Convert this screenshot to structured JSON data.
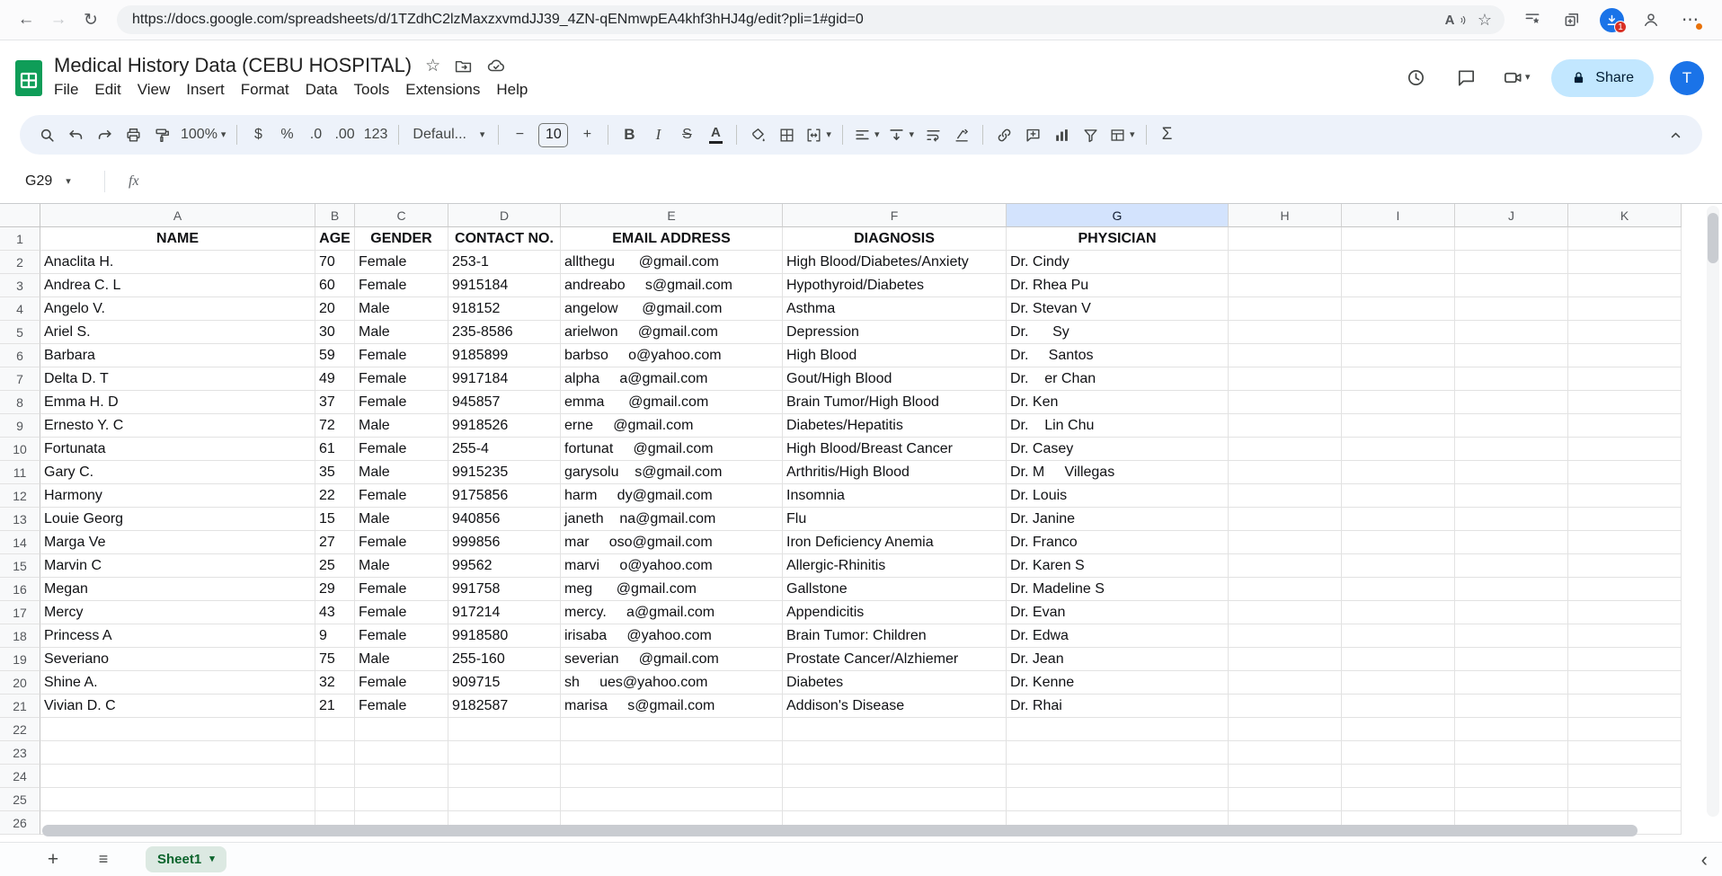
{
  "browser": {
    "url": "https://docs.google.com/spreadsheets/d/1TZdhC2lzMaxzxvmdJJ39_4ZN-qENmwpEA4khf3hHJ4g/edit?pli=1#gid=0",
    "downloads_badge": "1"
  },
  "icons": {
    "back": "←",
    "forward": "→",
    "refresh": "↻",
    "read_aloud": "A",
    "favorite_star": "☆",
    "ellipsis": "⋯",
    "doc_star": "☆",
    "caret": "▾",
    "minus": "−",
    "plus": "+",
    "hamburger": "≡",
    "chevron_left": "‹",
    "downloads_arrow": "↓"
  },
  "header": {
    "title": "Medical History Data (CEBU HOSPITAL)",
    "menus": [
      "File",
      "Edit",
      "View",
      "Insert",
      "Format",
      "Data",
      "Tools",
      "Extensions",
      "Help"
    ],
    "share_label": "Share",
    "avatar_letter": "T"
  },
  "toolbar": {
    "zoom": "100%",
    "currency": "$",
    "percent": "%",
    "dec_dec": ".0",
    "dec_inc": ".00",
    "number_format": "123",
    "font_name": "Defaul...",
    "font_size": "10",
    "bold": "B",
    "italic": "I",
    "strike": "S",
    "text_color": "A",
    "functions": "Σ"
  },
  "formula_bar": {
    "cell_ref": "G29",
    "fx_label": "fx"
  },
  "grid": {
    "column_letters": [
      "A",
      "B",
      "C",
      "D",
      "E",
      "F",
      "G",
      "H",
      "I",
      "J",
      "K"
    ],
    "selected_column": "G",
    "visible_rows": 26,
    "header_row": [
      "NAME",
      "AGE",
      "GENDER",
      "CONTACT NO.",
      "EMAIL ADDRESS",
      "DIAGNOSIS",
      "PHYSICIAN"
    ],
    "rows": [
      {
        "name": "Anaclita H.",
        "age": "70",
        "gender": "Female",
        "contact": "253-1",
        "email": "allthegu      @gmail.com",
        "diagnosis": "High Blood/Diabetes/Anxiety",
        "physician": "Dr. Cindy"
      },
      {
        "name": "Andrea C. L",
        "age": "60",
        "gender": "Female",
        "contact": "9915184",
        "email": "andreabo     s@gmail.com",
        "diagnosis": "Hypothyroid/Diabetes",
        "physician": "Dr. Rhea Pu"
      },
      {
        "name": "Angelo V.",
        "age": "20",
        "gender": "Male",
        "contact": "918152",
        "email": "angelow      @gmail.com",
        "diagnosis": "Asthma",
        "physician": "Dr. Stevan V"
      },
      {
        "name": "Ariel S.",
        "age": "30",
        "gender": "Male",
        "contact": "235-8586",
        "email": "arielwon     @gmail.com",
        "diagnosis": "Depression",
        "physician": "Dr.      Sy"
      },
      {
        "name": "Barbara",
        "age": "59",
        "gender": "Female",
        "contact": "9185899",
        "email": "barbso     o@yahoo.com",
        "diagnosis": "High Blood",
        "physician": "Dr.     Santos"
      },
      {
        "name": "Delta D. T",
        "age": "49",
        "gender": "Female",
        "contact": "9917184",
        "email": "alpha     a@gmail.com",
        "diagnosis": "Gout/High Blood",
        "physician": "Dr.    er Chan"
      },
      {
        "name": "Emma H. D",
        "age": "37",
        "gender": "Female",
        "contact": "945857",
        "email": "emma      @gmail.com",
        "diagnosis": "Brain Tumor/High Blood",
        "physician": "Dr. Ken"
      },
      {
        "name": "Ernesto Y. C",
        "age": "72",
        "gender": "Male",
        "contact": "9918526",
        "email": "erne     @gmail.com",
        "diagnosis": "Diabetes/Hepatitis",
        "physician": "Dr.    Lin Chu"
      },
      {
        "name": "Fortunata",
        "age": "61",
        "gender": "Female",
        "contact": "255-4",
        "email": "fortunat     @gmail.com",
        "diagnosis": "High Blood/Breast Cancer",
        "physician": "Dr. Casey"
      },
      {
        "name": "Gary C.",
        "age": "35",
        "gender": "Male",
        "contact": "9915235",
        "email": "garysolu    s@gmail.com",
        "diagnosis": "Arthritis/High Blood",
        "physician": "Dr. M     Villegas"
      },
      {
        "name": "Harmony",
        "age": "22",
        "gender": "Female",
        "contact": "9175856",
        "email": "harm     dy@gmail.com",
        "diagnosis": "Insomnia",
        "physician": "Dr. Louis"
      },
      {
        "name": "Louie Georg",
        "age": "15",
        "gender": "Male",
        "contact": "940856",
        "email": "janeth    na@gmail.com",
        "diagnosis": "Flu",
        "physician": "Dr. Janine"
      },
      {
        "name": "Marga Ve",
        "age": "27",
        "gender": "Female",
        "contact": "999856",
        "email": "mar     oso@gmail.com",
        "diagnosis": "Iron Deficiency Anemia",
        "physician": "Dr. Franco"
      },
      {
        "name": "Marvin C",
        "age": "25",
        "gender": "Male",
        "contact": "99562",
        "email": "marvi     o@yahoo.com",
        "diagnosis": "Allergic-Rhinitis",
        "physician": "Dr. Karen S"
      },
      {
        "name": "Megan",
        "age": "29",
        "gender": "Female",
        "contact": "991758",
        "email": "meg      @gmail.com",
        "diagnosis": "Gallstone",
        "physician": "Dr. Madeline S"
      },
      {
        "name": "Mercy",
        "age": "43",
        "gender": "Female",
        "contact": "917214",
        "email": "mercy.     a@gmail.com",
        "diagnosis": "Appendicitis",
        "physician": "Dr. Evan"
      },
      {
        "name": "Princess A",
        "age": "9",
        "gender": "Female",
        "contact": "9918580",
        "email": "irisaba     @yahoo.com",
        "diagnosis": "Brain Tumor: Children",
        "physician": "Dr. Edwa"
      },
      {
        "name": "Severiano",
        "age": "75",
        "gender": "Male",
        "contact": "255-160",
        "email": "severian     @gmail.com",
        "diagnosis": "Prostate Cancer/Alzhiemer",
        "physician": "Dr. Jean"
      },
      {
        "name": "Shine A.",
        "age": "32",
        "gender": "Female",
        "contact": "909715",
        "email": "sh     ues@yahoo.com",
        "diagnosis": "Diabetes",
        "physician": "Dr. Kenne"
      },
      {
        "name": "Vivian D. C",
        "age": "21",
        "gender": "Female",
        "contact": "9182587",
        "email": "marisa     s@gmail.com",
        "diagnosis": "Addison's Disease",
        "physician": "Dr. Rhai"
      }
    ]
  },
  "sheet_bar": {
    "sheet_name": "Sheet1"
  }
}
